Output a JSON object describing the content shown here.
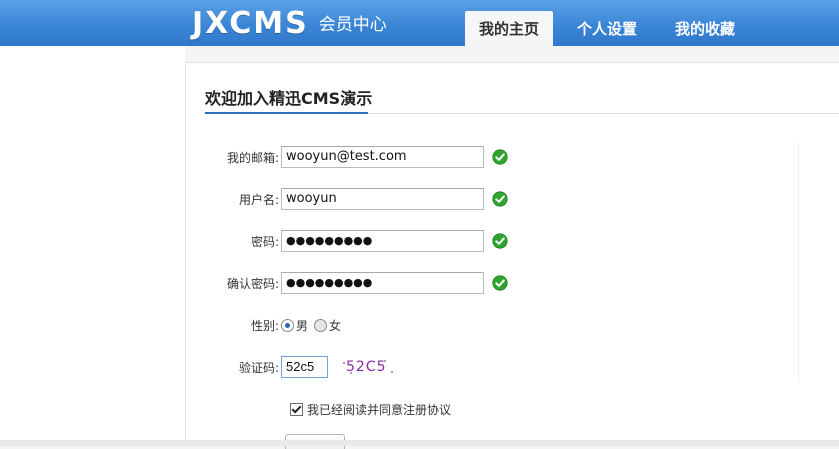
{
  "header": {
    "logo_text": "JXCMS",
    "logo_sub": "会员中心",
    "tabs": [
      {
        "label": "我的主页",
        "active": true
      },
      {
        "label": "个人设置",
        "active": false
      },
      {
        "label": "我的收藏",
        "active": false
      }
    ]
  },
  "card": {
    "title": "欢迎加入精迅CMS演示"
  },
  "form": {
    "email": {
      "label": "我的邮箱:",
      "value": "wooyun@test.com",
      "icon": "check-circle-icon"
    },
    "username": {
      "label": "用户名:",
      "value": "wooyun",
      "icon": "check-circle-icon"
    },
    "password": {
      "label": "密码:",
      "value": "●●●●●●●●●",
      "icon": "check-circle-icon"
    },
    "confirm": {
      "label": "确认密码:",
      "value": "●●●●●●●●●",
      "icon": "check-circle-icon"
    },
    "gender": {
      "label": "性别:",
      "options": [
        "男",
        "女"
      ],
      "selected": "男"
    },
    "captcha": {
      "label": "验证码:",
      "value": "52c5",
      "image_text": "52C5"
    },
    "agree": {
      "label": "我已经阅读并同意注册协议",
      "checked": true
    }
  },
  "colors": {
    "header_blue": "#3b85d6",
    "accent": "#2f6fbf",
    "ok_green": "#2fa52f"
  }
}
